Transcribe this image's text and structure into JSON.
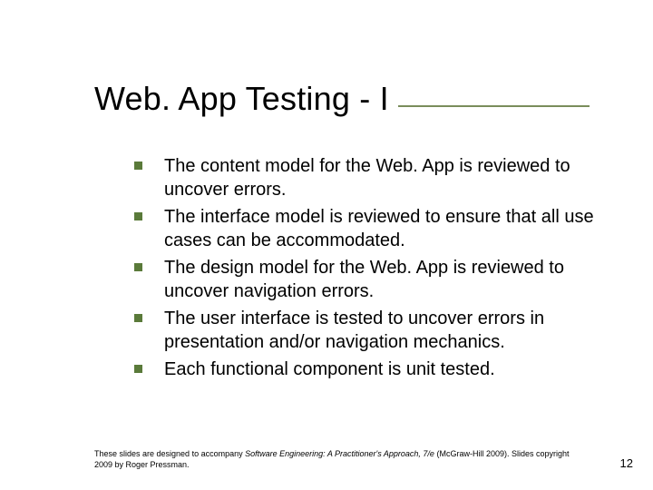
{
  "title": "Web. App Testing - I",
  "bullets": [
    "The content model for the Web. App is reviewed to uncover errors.",
    "The interface model is reviewed to ensure that all use cases can be accommodated.",
    "The design model for the Web. App is reviewed to uncover navigation errors.",
    "The user interface is tested to uncover errors in presentation and/or navigation mechanics.",
    "Each functional component is unit tested."
  ],
  "footer": {
    "pre": "These slides are designed to accompany ",
    "italic": "Software Engineering: A Practitioner's Approach, 7/e",
    "post": " (McGraw-Hill 2009). Slides copyright 2009 by Roger Pressman."
  },
  "page_number": "12"
}
